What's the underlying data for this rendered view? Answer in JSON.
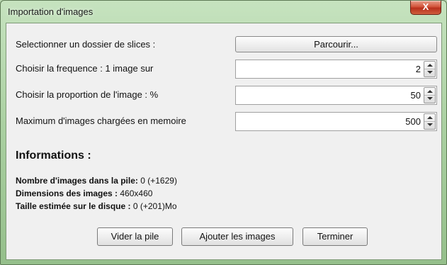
{
  "window": {
    "title": "Importation d'images",
    "close_glyph": "X"
  },
  "form": {
    "folder_label": "Selectionner un dossier de slices :",
    "browse_label": "Parcourir...",
    "frequency_label": "Choisir la frequence : 1 image sur",
    "frequency_value": "2",
    "proportion_label": "Choisir la proportion de l'image : %",
    "proportion_value": "50",
    "max_label": "Maximum d'images chargées en memoire",
    "max_value": "500"
  },
  "info": {
    "heading": "Informations :",
    "count_label": "Nombre d'images dans la pile:",
    "count_value": " 0 (+1629)",
    "dims_label": "Dimensions des images :",
    "dims_value": " 460x460",
    "size_label": "Taille estimée sur le disque :",
    "size_value": " 0 (+201)Mo"
  },
  "buttons": {
    "clear": "Vider la pile",
    "add": "Ajouter les images",
    "finish": "Terminer"
  },
  "icons": {
    "close": "close-icon",
    "spin_up": "arrow-up-icon",
    "spin_down": "arrow-down-icon"
  }
}
